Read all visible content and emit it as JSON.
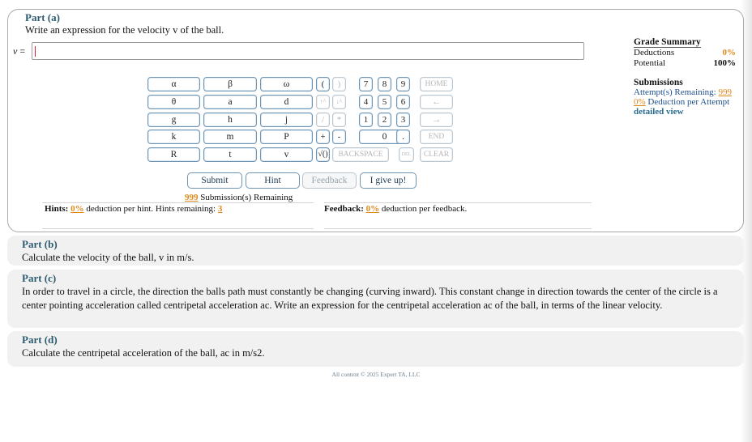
{
  "part_a": {
    "title": "Part (a)",
    "prompt": "Write an expression for the velocity v of the ball.",
    "answer_label_var": "v",
    "answer_label_eq": " =",
    "answer_value": ""
  },
  "grade_summary": {
    "title": "Grade Summary",
    "deductions_label": "Deductions",
    "deductions_value": "0%",
    "potential_label": "Potential",
    "potential_value": "100%"
  },
  "submissions": {
    "title": "Submissions",
    "attempts_label": "Attempt(s) Remaining:",
    "attempts_value": "999",
    "deduction_value": "0%",
    "deduction_label": "Deduction per Attempt",
    "detailed_view": "detailed view"
  },
  "keypad": {
    "vars": [
      "α",
      "β",
      "ω",
      "θ",
      "a",
      "d",
      "g",
      "h",
      "j",
      "k",
      "m",
      "P",
      "R",
      "t",
      "v"
    ],
    "ops": [
      "(",
      ")",
      "↑^",
      "↓^",
      "/",
      "*",
      "+",
      "-",
      "√()",
      "7",
      "8",
      "9",
      "4",
      "5",
      "6",
      "1",
      "2",
      "3",
      "0",
      "."
    ],
    "home": "HOME",
    "left": "←",
    "right": "→",
    "end": "END",
    "backspace": "BACKSPACE",
    "del": "DEL",
    "clear": "CLEAR"
  },
  "actions": {
    "submit": "Submit",
    "hint": "Hint",
    "feedback": "Feedback",
    "give_up": "I give up!"
  },
  "status": {
    "remaining_num": "999",
    "remaining_text": " Submission(s) Remaining",
    "hints_label": "Hints:",
    "hints_pct": "0%",
    "hints_text": " deduction per hint. Hints remaining: ",
    "hints_remaining": "3",
    "feedback_label": "Feedback:",
    "feedback_pct": "0%",
    "feedback_text": " deduction per feedback."
  },
  "part_b": {
    "title": "Part (b)",
    "text": "Calculate the velocity of the ball, v in m/s."
  },
  "part_c": {
    "title": "Part (c)",
    "text": "In order to travel in a circle, the direction the balls path must constantly be changing (curving inward). This constant change in direction towards the center of the circle is a center pointing acceleration called centripetal acceleration ac. Write an expression for the centripetal acceleration ac of the ball, in terms of the linear velocity."
  },
  "part_d": {
    "title": "Part (d)",
    "text": "Calculate the centripetal acceleration of the ball, ac in m/s2."
  },
  "footer": "All content © 2025 Expert TA, LLC"
}
